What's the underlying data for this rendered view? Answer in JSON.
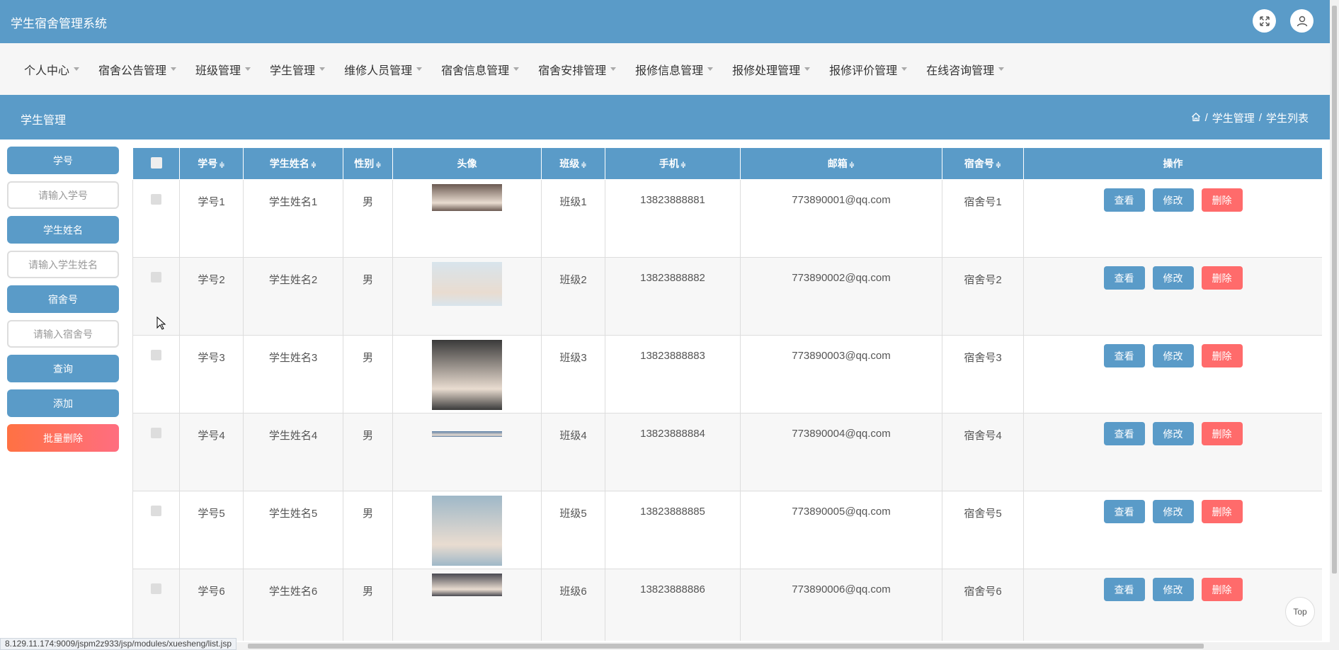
{
  "app": {
    "title": "学生宿舍管理系统"
  },
  "topbar_icons": [
    "fullscreen-icon",
    "user-icon"
  ],
  "nav": {
    "items": [
      {
        "label": "个人中心"
      },
      {
        "label": "宿舍公告管理"
      },
      {
        "label": "班级管理"
      },
      {
        "label": "学生管理"
      },
      {
        "label": "维修人员管理"
      },
      {
        "label": "宿舍信息管理"
      },
      {
        "label": "宿舍安排管理"
      },
      {
        "label": "报修信息管理"
      },
      {
        "label": "报修处理管理"
      },
      {
        "label": "报修评价管理"
      },
      {
        "label": "在线咨询管理"
      }
    ]
  },
  "header": {
    "section_title": "学生管理",
    "breadcrumb": [
      "学生管理",
      "学生列表"
    ],
    "breadcrumb_sep": "/"
  },
  "search": {
    "student_id_label": "学号",
    "student_id_placeholder": "请输入学号",
    "student_name_label": "学生姓名",
    "student_name_placeholder": "请输入学生姓名",
    "dorm_label": "宿舍号",
    "dorm_placeholder": "请输入宿舍号",
    "query_button": "查询",
    "add_button": "添加",
    "batch_delete_button": "批量删除"
  },
  "table": {
    "columns": [
      "学号",
      "学生姓名",
      "性别",
      "头像",
      "班级",
      "手机",
      "邮箱",
      "宿舍号",
      "操作"
    ],
    "sort_glyph": "≑",
    "actions": {
      "view": "查看",
      "edit": "修改",
      "delete": "删除"
    },
    "rows": [
      {
        "id": "学号1",
        "name": "学生姓名1",
        "gender": "男",
        "class": "班级1",
        "phone": "13823888881",
        "email": "773890001@qq.com",
        "dorm": "宿舍号1"
      },
      {
        "id": "学号2",
        "name": "学生姓名2",
        "gender": "男",
        "class": "班级2",
        "phone": "13823888882",
        "email": "773890002@qq.com",
        "dorm": "宿舍号2"
      },
      {
        "id": "学号3",
        "name": "学生姓名3",
        "gender": "男",
        "class": "班级3",
        "phone": "13823888883",
        "email": "773890003@qq.com",
        "dorm": "宿舍号3"
      },
      {
        "id": "学号4",
        "name": "学生姓名4",
        "gender": "男",
        "class": "班级4",
        "phone": "13823888884",
        "email": "773890004@qq.com",
        "dorm": "宿舍号4"
      },
      {
        "id": "学号5",
        "name": "学生姓名5",
        "gender": "男",
        "class": "班级5",
        "phone": "13823888885",
        "email": "773890005@qq.com",
        "dorm": "宿舍号5"
      },
      {
        "id": "学号6",
        "name": "学生姓名6",
        "gender": "男",
        "class": "班级6",
        "phone": "13823888886",
        "email": "773890006@qq.com",
        "dorm": "宿舍号6"
      }
    ]
  },
  "top_button": "Top",
  "status_url": "8.129.11.174:9009/jspm2z933/jsp/modules/xuesheng/list.jsp",
  "colors": {
    "primary": "#5a9bc8",
    "danger": "#ff6b6b",
    "nav_bg": "#f6f6f6"
  }
}
